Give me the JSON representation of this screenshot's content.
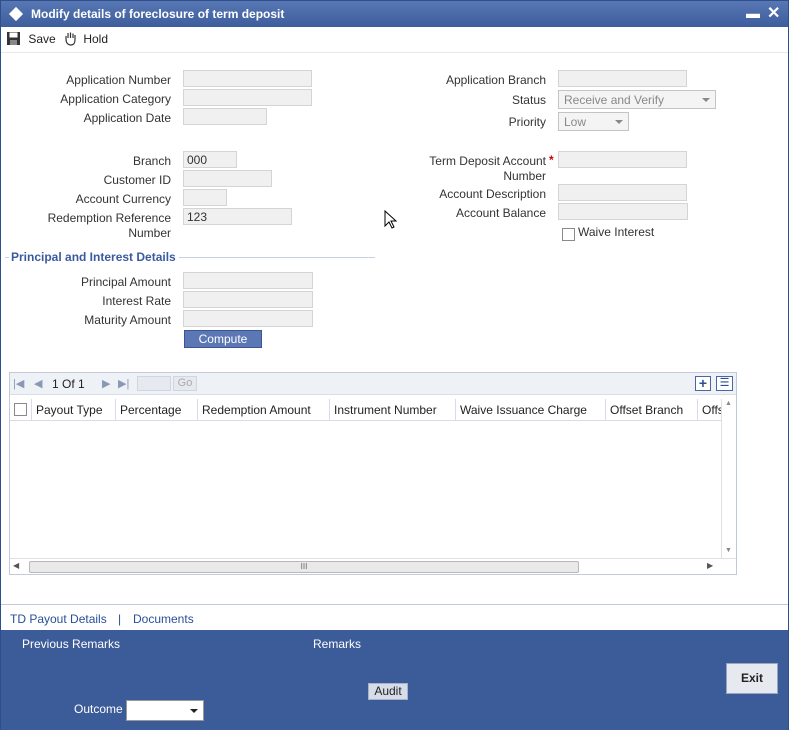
{
  "window": {
    "title": "Modify details of foreclosure of term deposit",
    "minimize": "▬",
    "close": "✕"
  },
  "toolbar": {
    "save_label": "Save",
    "hold_label": "Hold"
  },
  "left_fields": {
    "application_number_label": "Application Number",
    "application_number_value": "",
    "application_category_label": "Application Category",
    "application_category_value": "",
    "application_date_label": "Application Date",
    "application_date_value": "",
    "branch_label": "Branch",
    "branch_value": "000",
    "customer_id_label": "Customer ID",
    "customer_id_value": "",
    "account_currency_label": "Account Currency",
    "account_currency_value": "",
    "redemption_ref_label_1": "Redemption Reference",
    "redemption_ref_label_2": "Number",
    "redemption_ref_value": "123"
  },
  "right_fields": {
    "application_branch_label": "Application Branch",
    "application_branch_value": "",
    "status_label": "Status",
    "status_value": "Receive and Verify",
    "priority_label": "Priority",
    "priority_value": "Low",
    "td_account_label_1": "Term Deposit Account",
    "td_account_required": "*",
    "td_account_label_2": "Number",
    "td_account_value": "",
    "account_description_label": "Account Description",
    "account_description_value": "",
    "account_balance_label": "Account Balance",
    "account_balance_value": "",
    "waive_interest_label": "Waive Interest",
    "waive_interest_checked": false
  },
  "principal_section": {
    "title": "Principal and Interest Details",
    "principal_amount_label": "Principal Amount",
    "principal_amount_value": "",
    "interest_rate_label": "Interest Rate",
    "interest_rate_value": "",
    "maturity_amount_label": "Maturity Amount",
    "maturity_amount_value": "",
    "compute_label": "Compute"
  },
  "grid": {
    "pager": {
      "first": "|◀",
      "prev": "◀",
      "info": "1 Of 1",
      "next": "▶",
      "last": "▶|",
      "page_input": "",
      "go": "Go"
    },
    "add_icon": "+",
    "list_icon": "☰",
    "columns": [
      "Payout Type",
      "Percentage",
      "Redemption Amount",
      "Instrument Number",
      "Waive Issuance Charge",
      "Offset Branch",
      "Offs"
    ],
    "rows": [],
    "hscroll_grip": "III",
    "vscroll_up": "▲",
    "vscroll_down": "▼",
    "hscroll_left": "◀",
    "hscroll_right": "▶"
  },
  "tabs": {
    "td_payout": "TD Payout Details",
    "separator": "|",
    "documents": "Documents"
  },
  "footer": {
    "previous_remarks": "Previous Remarks",
    "remarks": "Remarks",
    "audit": "Audit",
    "exit": "Exit",
    "outcome_label": "Outcome",
    "outcome_value": ""
  }
}
